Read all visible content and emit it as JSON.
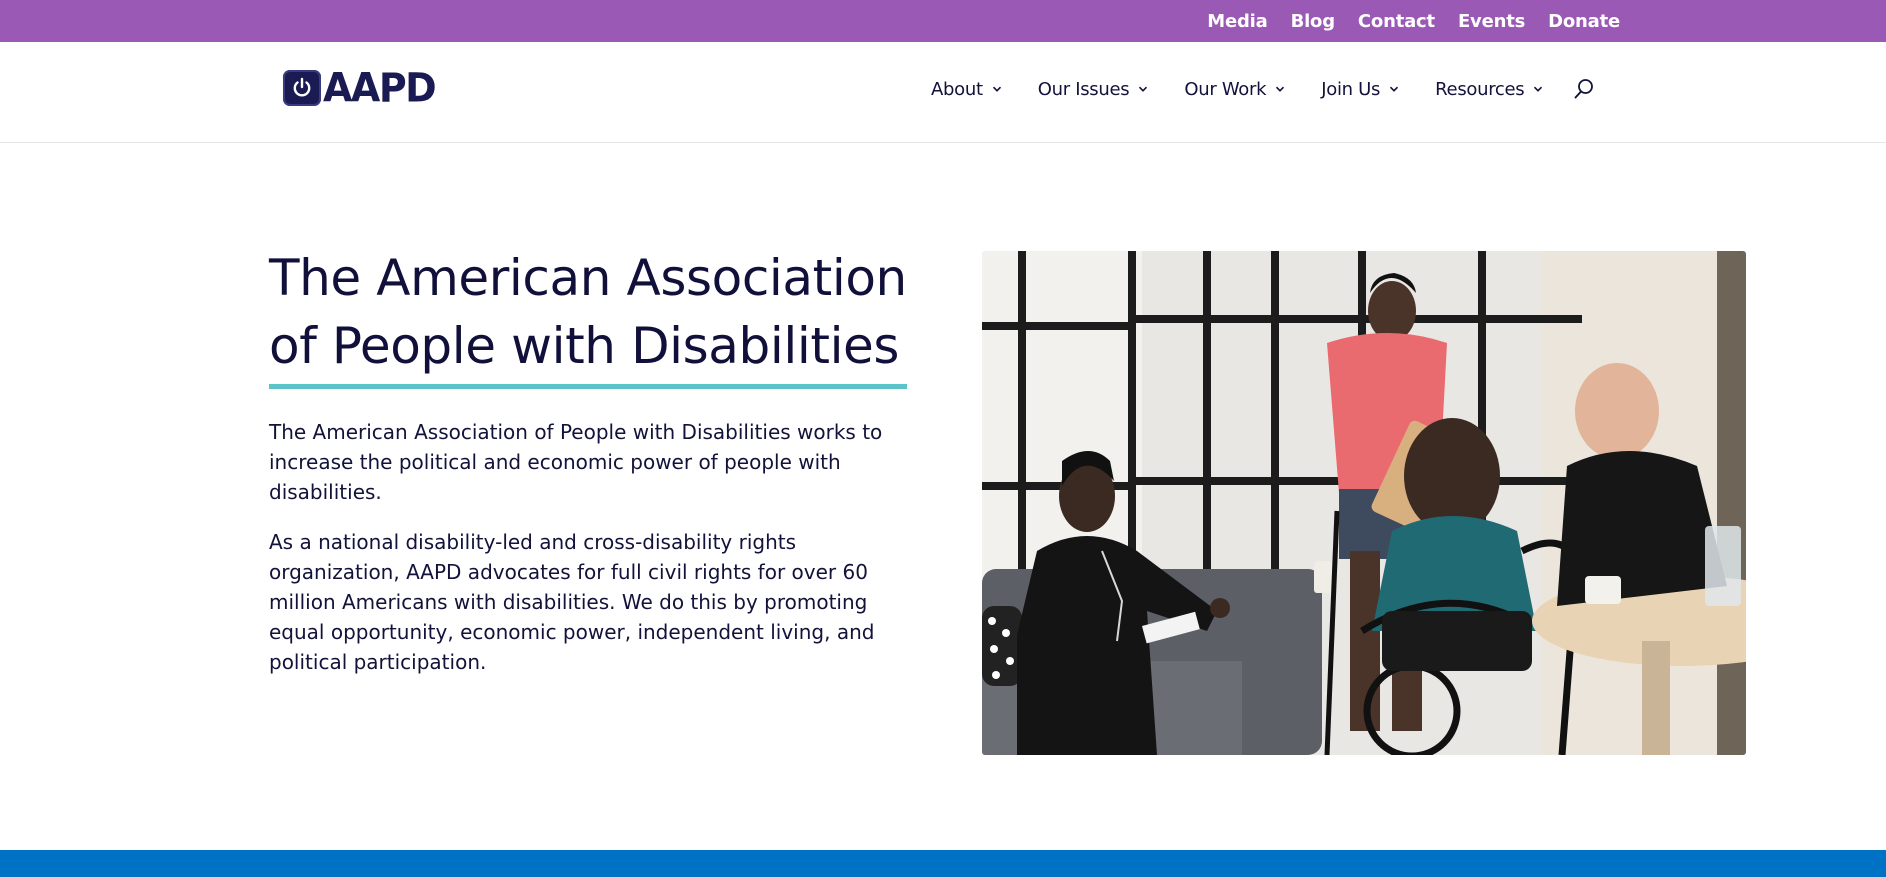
{
  "topbar": {
    "links": [
      "Media",
      "Blog",
      "Contact",
      "Events",
      "Donate"
    ]
  },
  "header": {
    "logo_text": "AAPD",
    "nav": [
      "About",
      "Our Issues",
      "Our Work",
      "Join Us",
      "Resources"
    ]
  },
  "hero": {
    "title_line1": "The American Association",
    "title_line2": "of People with Disabilities",
    "paragraph1": "The American Association of People with Disabilities works to increase the political and economic power of people with disabilities.",
    "paragraph2": "As a national disability-led and cross-disability rights organization, AAPD advocates for full civil rights for over 60 million Americans with disabilities. We do this by promoting equal opportunity, economic power, independent living, and political participation."
  },
  "colors": {
    "topbar": "#9b59b6",
    "brand_navy": "#1b1b54",
    "accent_teal": "#5bc4c9",
    "footer_blue": "#0072c6"
  }
}
